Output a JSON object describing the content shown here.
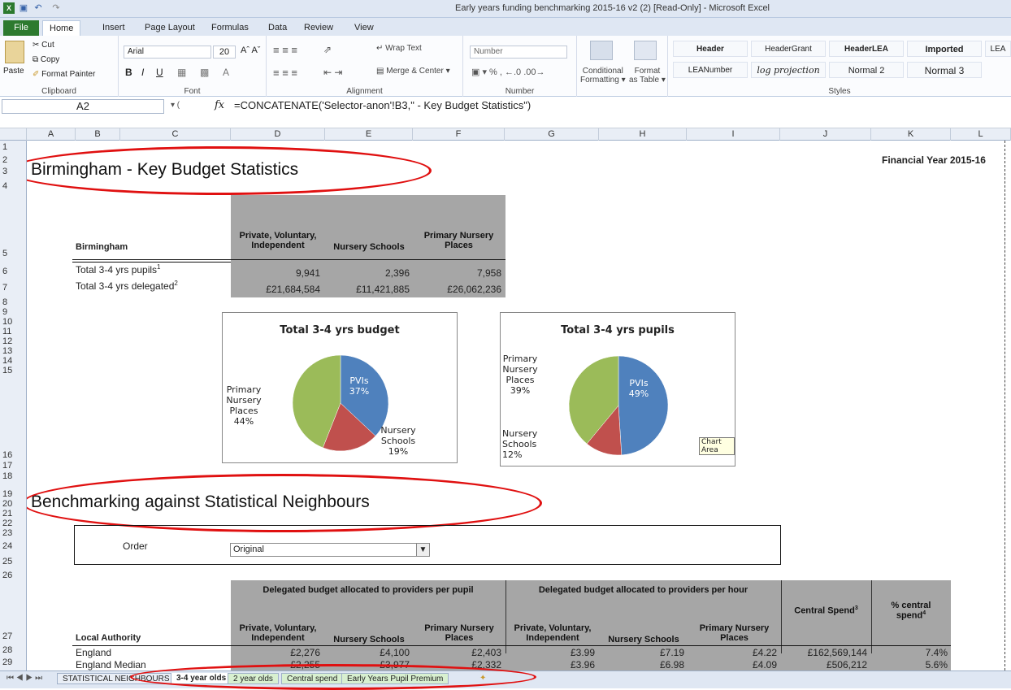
{
  "window": {
    "title": "Early years funding benchmarking 2015-16 v2 (2)  [Read-Only]  -  Microsoft Excel"
  },
  "tabs": [
    "File",
    "Home",
    "Insert",
    "Page Layout",
    "Formulas",
    "Data",
    "Review",
    "View"
  ],
  "ribbon": {
    "clipboard": {
      "paste": "Paste",
      "cut": "Cut",
      "copy": "Copy",
      "format_painter": "Format Painter",
      "label": "Clipboard"
    },
    "font": {
      "name": "Arial",
      "size": "20",
      "label": "Font"
    },
    "alignment": {
      "wrap": "Wrap Text",
      "merge": "Merge & Center",
      "label": "Alignment"
    },
    "number": {
      "format": "Number",
      "label": "Number"
    },
    "cond": {
      "conditional": "Conditional",
      "formatting": "Formatting",
      "format": "Format",
      "as_table": "as Table"
    },
    "styles": {
      "label": "Styles",
      "items": [
        "Header",
        "HeaderGrant",
        "HeaderLEA",
        "Imported",
        "LEA",
        "LEANumber",
        "log projection",
        "Normal 2",
        "Normal 3"
      ]
    }
  },
  "formula_bar": {
    "name_box": "A2",
    "fx": "fx",
    "formula": "=CONCATENATE('Selector-anon'!B3,\" - Key Budget Statistics\")"
  },
  "columns": [
    "A",
    "B",
    "C",
    "D",
    "E",
    "F",
    "G",
    "H",
    "I",
    "J",
    "K",
    "L"
  ],
  "rows": [
    "1",
    "2",
    "3",
    "4",
    "5",
    "6",
    "7",
    "8",
    "9",
    "10",
    "11",
    "12",
    "13",
    "14",
    "15",
    "16",
    "17",
    "18",
    "19",
    "20",
    "21",
    "22",
    "23",
    "24",
    "25",
    "26",
    "27",
    "28",
    "29"
  ],
  "sheet": {
    "title": "Birmingham - Key Budget Statistics",
    "financial_year": "Financial Year 2015-16",
    "key_table": {
      "row_label": "Birmingham",
      "headers": [
        "Private, Voluntary, Independent",
        "Nursery Schools",
        "Primary Nursery Places"
      ],
      "rows": [
        {
          "label": "Total 3-4 yrs pupils",
          "sup": "1",
          "values": [
            "9,941",
            "2,396",
            "7,958"
          ]
        },
        {
          "label": "Total 3-4 yrs delegated",
          "sup": "2",
          "values": [
            "£21,684,584",
            "£11,421,885",
            "£26,062,236"
          ]
        }
      ]
    },
    "section2": "Benchmarking against Statistical Neighbours",
    "order_label": "Order",
    "order_value": "Original",
    "bench_table": {
      "group1": "Delegated budget allocated to providers per pupil",
      "group2": "Delegated budget allocated to providers per hour",
      "central": "Central Spend",
      "central_sup": "3",
      "pct": "% central spend",
      "pct_sup": "4",
      "la": "Local Authority",
      "sub": [
        "Private, Voluntary, Independent",
        "Nursery Schools",
        "Primary Nursery Places",
        "Private, Voluntary, Independent",
        "Nursery Schools",
        "Primary Nursery Places"
      ],
      "rows": [
        {
          "label": "England",
          "values": [
            "£2,276",
            "£4,100",
            "£2,403",
            "£3.99",
            "£7.19",
            "£4.22",
            "£162,569,144",
            "7.4%"
          ]
        },
        {
          "label": "England Median",
          "values": [
            "£2,255",
            "£3,977",
            "£2,332",
            "£3.96",
            "£6.98",
            "£4.09",
            "£506,212",
            "5.6%"
          ]
        }
      ]
    },
    "tooltip": "Chart Area"
  },
  "chart_data": [
    {
      "type": "pie",
      "title": "Total  3-4 yrs budget",
      "categories": [
        "PVIs",
        "Nursery Schools",
        "Primary Nursery Places"
      ],
      "values": [
        37,
        19,
        44
      ],
      "labels": [
        "PVIs",
        "Nursery Schools",
        "Primary Nursery Places"
      ],
      "colors": [
        "#4f81bd",
        "#c0504d",
        "#9bbb59"
      ]
    },
    {
      "type": "pie",
      "title": "Total  3-4 yrs pupils",
      "categories": [
        "PVIs",
        "Nursery Schools",
        "Primary Nursery Places"
      ],
      "values": [
        49,
        12,
        39
      ],
      "labels": [
        "PVIs",
        "Nursery Schools",
        "Primary Nursery Places"
      ],
      "colors": [
        "#4f81bd",
        "#c0504d",
        "#9bbb59"
      ]
    }
  ],
  "sheet_tabs": [
    "STATISTICAL NEIGHBOURS",
    "3-4 year olds",
    "2 year olds",
    "Central spend",
    "Early Years Pupil Premium"
  ]
}
